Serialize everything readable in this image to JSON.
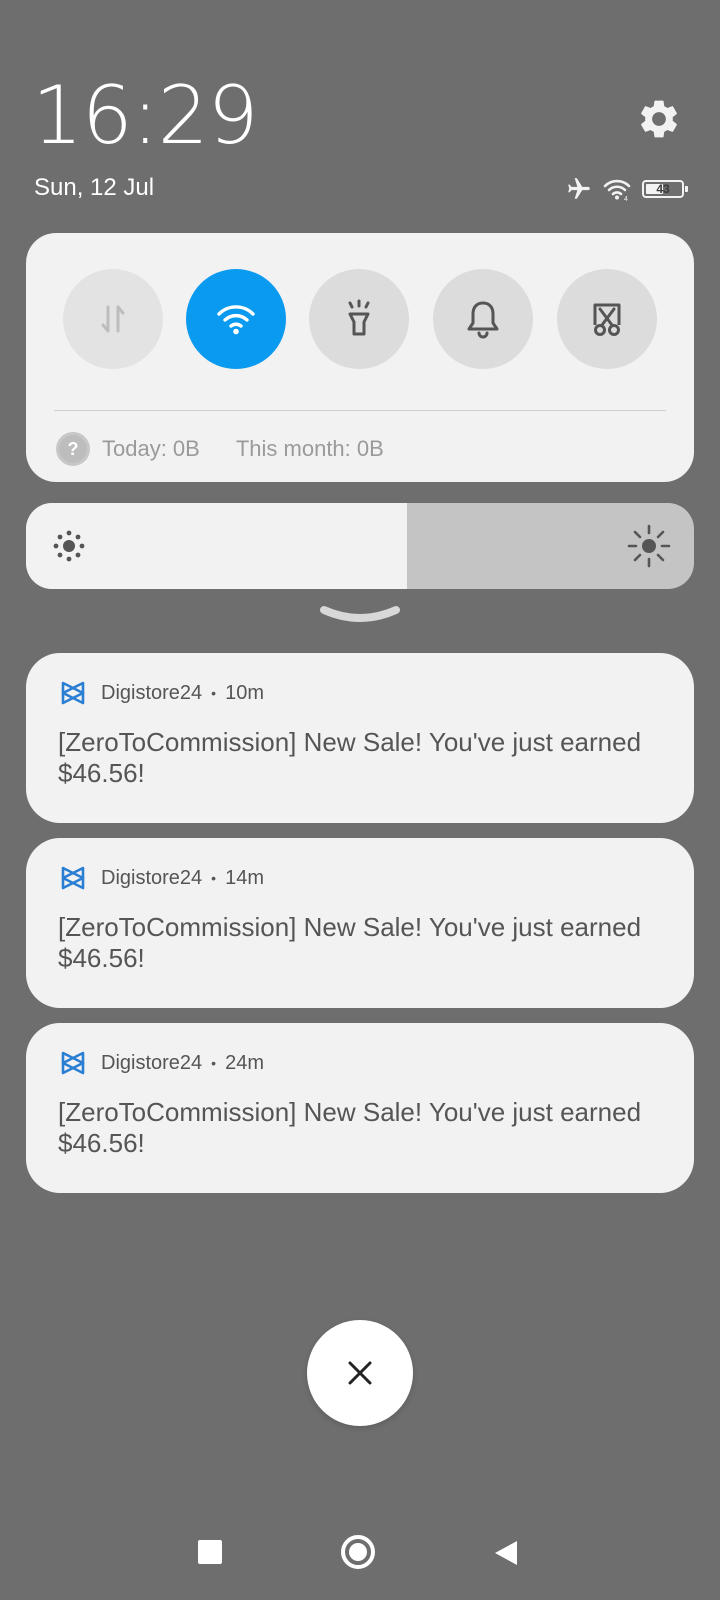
{
  "status": {
    "time": "16:29",
    "date": "Sun, 12 Jul",
    "battery_level": "43",
    "battery_fraction": 0.43,
    "icons": [
      "airplane-icon",
      "wifi-signal-icon",
      "battery-icon"
    ]
  },
  "quick_settings": {
    "tiles": [
      {
        "name": "mobile-data",
        "icon": "data-arrows-icon",
        "state": "disabled"
      },
      {
        "name": "wifi",
        "icon": "wifi-icon",
        "state": "on"
      },
      {
        "name": "flashlight",
        "icon": "flashlight-icon",
        "state": "off"
      },
      {
        "name": "sound",
        "icon": "bell-icon",
        "state": "off"
      },
      {
        "name": "screenshot",
        "icon": "scissors-screenshot-icon",
        "state": "off"
      }
    ],
    "data_usage": {
      "today": "Today: 0B",
      "month": "This month: 0B"
    },
    "accent_color": "#0a9af0"
  },
  "brightness": {
    "level": 0.57
  },
  "notifications": [
    {
      "app": "Digistore24",
      "separator": "•",
      "time": "10m",
      "text": "[ZeroToCommission] New Sale! You've just earned $46.56!"
    },
    {
      "app": "Digistore24",
      "separator": "•",
      "time": "14m",
      "text": "[ZeroToCommission] New Sale! You've just earned $46.56!"
    },
    {
      "app": "Digistore24",
      "separator": "•",
      "time": "24m",
      "text": "[ZeroToCommission] New Sale! You've just earned $46.56!"
    }
  ],
  "colors": {
    "shade_background": "#6e6e6e",
    "panel": "#f2f2f2",
    "app_icon": "#2b7fd3"
  }
}
